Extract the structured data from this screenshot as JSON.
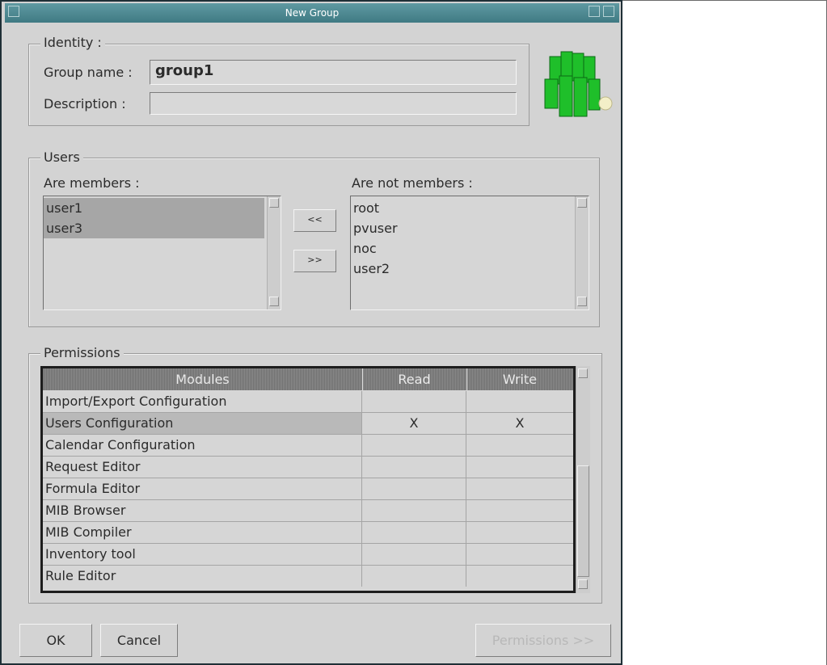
{
  "window": {
    "title": "New Group"
  },
  "identity": {
    "legend": "Identity :",
    "group_name_label": "Group name  :",
    "group_name_value": "group1",
    "description_label": "Description :",
    "description_value": ""
  },
  "users": {
    "legend": "Users",
    "members_label": "Are members :",
    "non_members_label": "Are not members :",
    "members": [
      "user1",
      "user3"
    ],
    "non_members": [
      "root",
      "pvuser",
      "noc",
      "user2"
    ],
    "add_button_label": "<<",
    "remove_button_label": ">>"
  },
  "permissions": {
    "legend": "Permissions",
    "columns": [
      "Modules",
      "Read",
      "Write"
    ],
    "rows": [
      {
        "module": "Import/Export Configuration",
        "read": "",
        "write": ""
      },
      {
        "module": "Users Configuration",
        "read": "X",
        "write": "X"
      },
      {
        "module": "Calendar Configuration",
        "read": "",
        "write": ""
      },
      {
        "module": "Request Editor",
        "read": "",
        "write": ""
      },
      {
        "module": "Formula Editor",
        "read": "",
        "write": ""
      },
      {
        "module": "MIB Browser",
        "read": "",
        "write": ""
      },
      {
        "module": "MIB Compiler",
        "read": "",
        "write": ""
      },
      {
        "module": "Inventory tool",
        "read": "",
        "write": ""
      },
      {
        "module": "Rule Editor",
        "read": "",
        "write": ""
      }
    ]
  },
  "buttons": {
    "ok": "OK",
    "cancel": "Cancel",
    "permissions": "Permissions >>"
  },
  "colors": {
    "titlebar": "#4f8a93",
    "window_bg": "#d3d3d3",
    "selection": "#a6a6a6",
    "group_icon": "#1fbf2a"
  }
}
